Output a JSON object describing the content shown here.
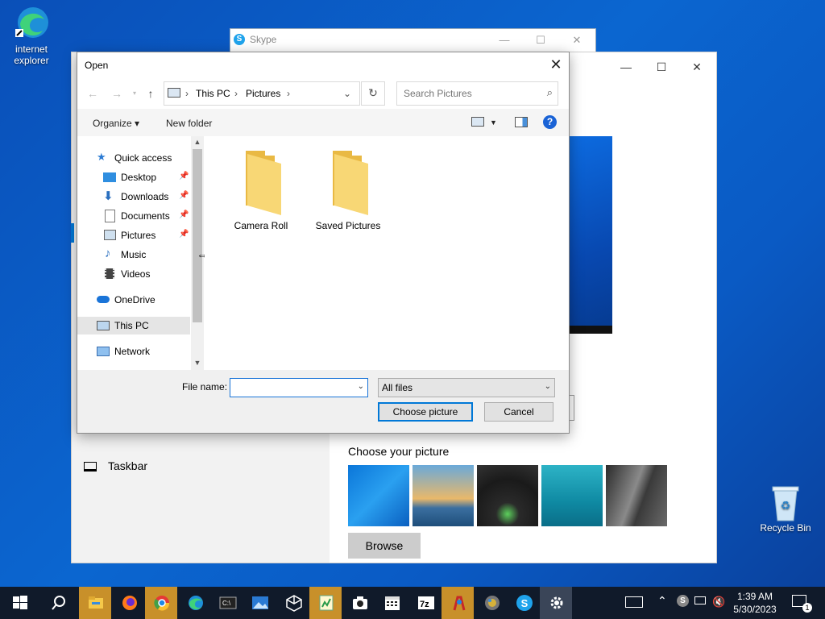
{
  "desktop": {
    "icons": [
      {
        "label": "internet explorer"
      },
      {
        "label": "Recycle Bin"
      }
    ]
  },
  "skype_window": {
    "title": "Skype"
  },
  "settings_window": {
    "taskbar_item": "Taskbar",
    "choose_picture_label": "Choose your picture",
    "browse_label": "Browse"
  },
  "dialog": {
    "title": "Open",
    "close_glyph": "✕",
    "address": {
      "segments": [
        "This PC",
        "Pictures"
      ]
    },
    "search": {
      "placeholder": "Search Pictures"
    },
    "toolbar": {
      "organize_label": "Organize ▾",
      "new_folder_label": "New folder",
      "help_glyph": "?"
    },
    "nav": [
      {
        "label": "Quick access"
      },
      {
        "label": "Desktop"
      },
      {
        "label": "Downloads"
      },
      {
        "label": "Documents"
      },
      {
        "label": "Pictures"
      },
      {
        "label": "Music"
      },
      {
        "label": "Videos"
      },
      {
        "label": "OneDrive"
      },
      {
        "label": "This PC"
      },
      {
        "label": "Network"
      }
    ],
    "folders": [
      {
        "name": "Camera Roll"
      },
      {
        "name": "Saved Pictures"
      }
    ],
    "file_name_label": "File name:",
    "file_name_value": "",
    "file_type": "All files",
    "choose_button": "Choose picture",
    "cancel_button": "Cancel"
  },
  "taskbar": {
    "clock_time": "1:39 AM",
    "clock_date": "5/30/2023",
    "notification_count": "1"
  },
  "colors": {
    "accent": "#0078d7",
    "folder": "#f5d06a",
    "taskbar": "#101a2a"
  }
}
